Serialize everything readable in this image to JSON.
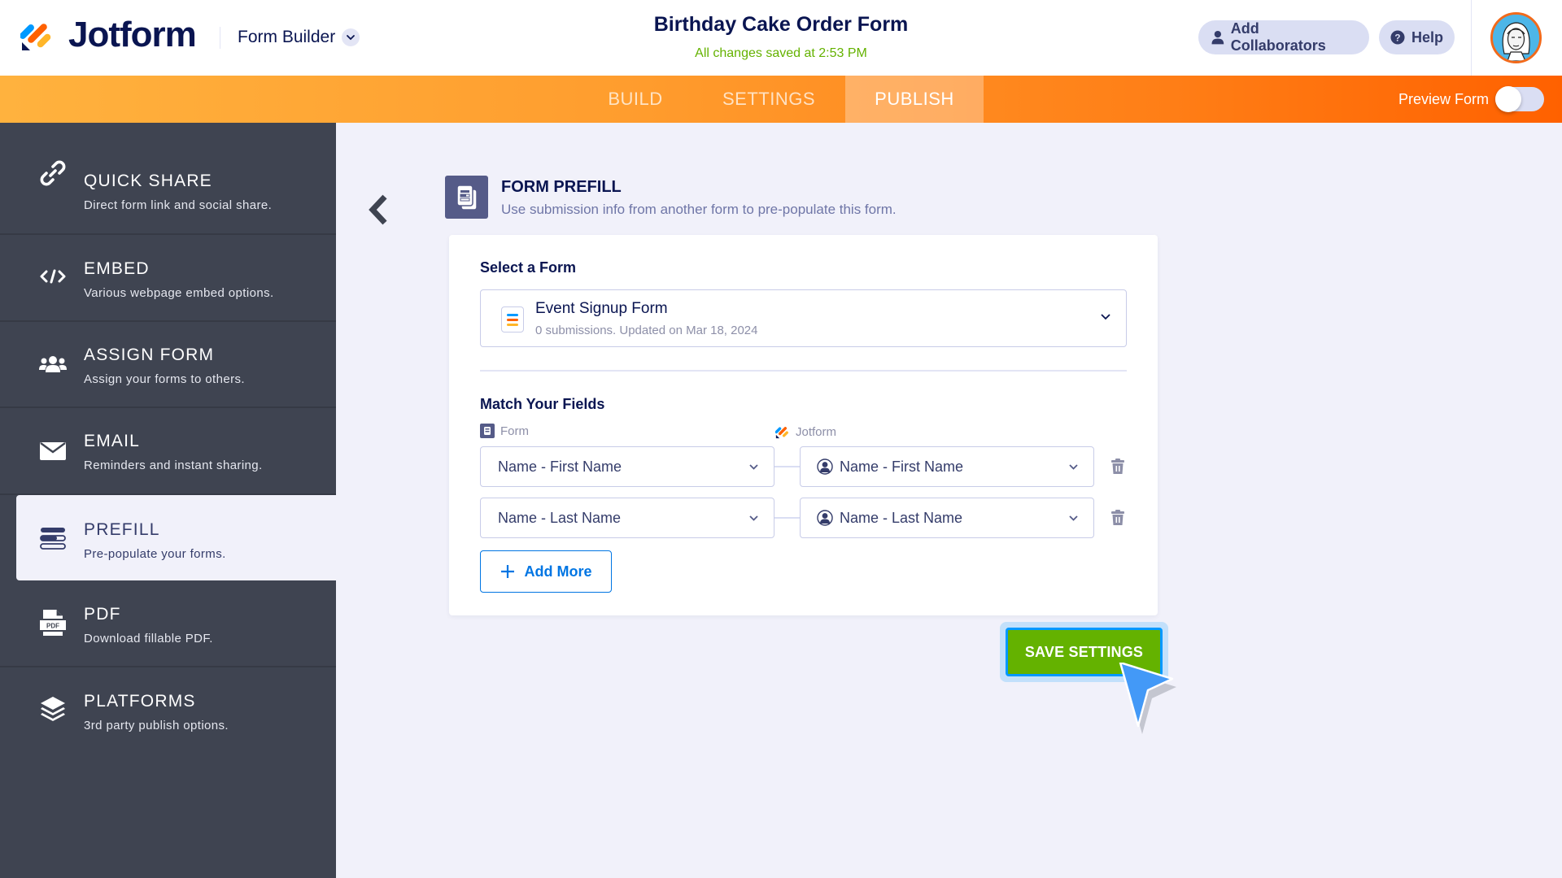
{
  "header": {
    "logo_text": "Jotform",
    "builder_menu_label": "Form Builder",
    "form_title": "Birthday Cake Order Form",
    "save_status": "All changes saved at 2:53 PM",
    "add_collaborators_label": "Add Collaborators",
    "help_label": "Help",
    "avatar_icon": "user-avatar"
  },
  "navbar": {
    "tabs": [
      {
        "label": "BUILD",
        "active": false
      },
      {
        "label": "SETTINGS",
        "active": false
      },
      {
        "label": "PUBLISH",
        "active": true
      }
    ],
    "preview_label": "Preview Form",
    "preview_enabled": false
  },
  "sidebar": {
    "items": [
      {
        "title": "QUICK SHARE",
        "desc": "Direct form link and social share.",
        "icon": "link-icon"
      },
      {
        "title": "EMBED",
        "desc": "Various webpage embed options.",
        "icon": "code-icon"
      },
      {
        "title": "ASSIGN FORM",
        "desc": "Assign your forms to others.",
        "icon": "users-icon"
      },
      {
        "title": "EMAIL",
        "desc": "Reminders and instant sharing.",
        "icon": "envelope-icon"
      },
      {
        "title": "PREFILL",
        "desc": "Pre-populate your forms.",
        "icon": "prefill-icon",
        "active": true
      },
      {
        "title": "PDF",
        "desc": "Download fillable PDF.",
        "icon": "pdf-icon"
      },
      {
        "title": "PLATFORMS",
        "desc": "3rd party publish options.",
        "icon": "layers-icon"
      }
    ]
  },
  "main": {
    "section_title": "FORM PREFILL",
    "section_subtitle": "Use submission info from another form to pre-populate this form.",
    "select_form_label": "Select a Form",
    "selected_form": {
      "name": "Event Signup Form",
      "meta": "0 submissions. Updated on Mar 18, 2024"
    },
    "match_fields_label": "Match Your Fields",
    "col_form_label": "Form",
    "col_jotform_label": "Jotform",
    "mappings": [
      {
        "source": "Name - First Name",
        "target": "Name - First Name"
      },
      {
        "source": "Name - Last Name",
        "target": "Name - Last Name"
      }
    ],
    "add_more_label": "Add More",
    "save_label": "SAVE SETTINGS"
  },
  "colors": {
    "brand_navy": "#0A1551",
    "orange": "#FF6100",
    "green_save": "#64B200",
    "blue_accent": "#0075E3",
    "sidebar_bg": "#3F4451"
  }
}
